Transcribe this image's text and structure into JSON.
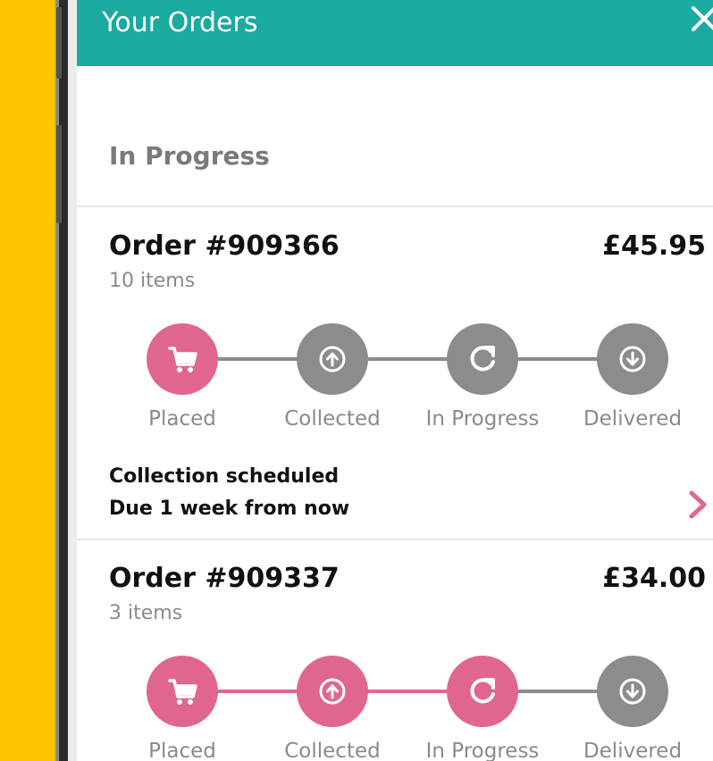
{
  "header": {
    "title": "Your Orders",
    "close_icon": "close-icon"
  },
  "section": {
    "title": "In Progress"
  },
  "colors": {
    "header": "#1baaa0",
    "active": "#e0668f",
    "inactive": "#8c8c8c",
    "background": "#ffc400"
  },
  "orders": [
    {
      "number": "Order #909366",
      "price": "£45.95",
      "items": "10 items",
      "steps": [
        {
          "label": "Placed",
          "icon": "cart-icon",
          "active": true
        },
        {
          "label": "Collected",
          "icon": "upload-icon",
          "active": false
        },
        {
          "label": "In Progress",
          "icon": "refresh-icon",
          "active": false
        },
        {
          "label": "Delivered",
          "icon": "download-icon",
          "active": false
        }
      ],
      "status_line1": "Collection scheduled",
      "status_line2": "Due 1 week from now"
    },
    {
      "number": "Order #909337",
      "price": "£34.00",
      "items": "3 items",
      "steps": [
        {
          "label": "Placed",
          "icon": "cart-icon",
          "active": true
        },
        {
          "label": "Collected",
          "icon": "upload-icon",
          "active": true
        },
        {
          "label": "In Progress",
          "icon": "refresh-icon",
          "active": true
        },
        {
          "label": "Delivered",
          "icon": "download-icon",
          "active": false
        }
      ]
    }
  ]
}
